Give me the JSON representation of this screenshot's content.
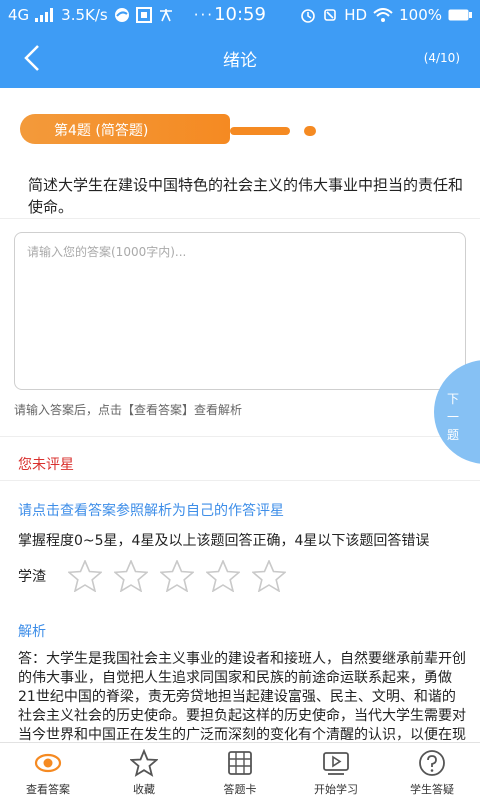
{
  "status": {
    "network": "4G",
    "speed": "3.5K/s",
    "time": "10:59",
    "hd": "HD",
    "battery": "100%"
  },
  "nav": {
    "title": "绪论",
    "progress": "(4/10)"
  },
  "question": {
    "type_label": "第4题 (简答题)",
    "text": "简述大学生在建设中国特色的社会主义的伟大事业中担当的责任和使命。"
  },
  "answer": {
    "placeholder": "请输入您的答案(1000字内)...",
    "hint": "请输入答案后，点击【查看答案】查看解析"
  },
  "next_button": "下一题",
  "rating": {
    "status": "您未评星",
    "prompt": "请点击查看答案参照解析为自己的作答评星",
    "mastery_desc": "掌握程度0~5星，4星及以上该题回答正确，4星以下该题回答错误",
    "low_label": "学渣",
    "stars_filled": 0,
    "stars_total": 5
  },
  "analysis": {
    "title": "解析",
    "text": "答：大学生是我国社会主义事业的建设者和接班人，自然要继承前辈开创的伟大事业，自觉把人生追求同国家和民族的前途命运联系起来，勇做21世纪中国的脊梁，责无旁贷地担当起建设富强、民主、文明、和谐的社会主义社会的历史使命。要担负起这样的历史使命，当代大学生需要对当今世界和中国正在发生的广泛而深刻的变化有个清醒的认识，以便在现实的基础上迎接挑战"
  },
  "tabs": [
    {
      "label": "查看答案",
      "icon": "eye-icon"
    },
    {
      "label": "收藏",
      "icon": "star-icon"
    },
    {
      "label": "答题卡",
      "icon": "grid-icon"
    },
    {
      "label": "开始学习",
      "icon": "play-icon"
    },
    {
      "label": "学生答疑",
      "icon": "question-icon"
    }
  ],
  "colors": {
    "primary": "#3e9cf5",
    "accent_orange": "#f58a22",
    "warning_red": "#d9302d",
    "link_blue": "#3e8ee8"
  }
}
